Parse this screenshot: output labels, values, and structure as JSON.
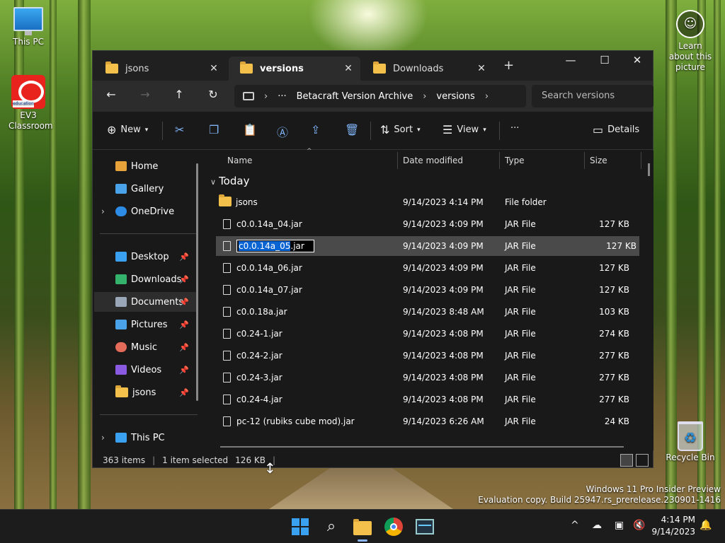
{
  "desktop": {
    "icons": [
      {
        "label": "This PC",
        "icon": "monitor-icon"
      },
      {
        "label": "EV3 Classroom",
        "icon": "ev3-app-icon"
      },
      {
        "label": "Recycle Bin",
        "icon": "recycle-bin-icon"
      },
      {
        "label": "Learn about this picture",
        "icon": "learn-picture-icon"
      }
    ],
    "watermark": {
      "line1": "Windows 11 Pro Insider Preview",
      "line2": "Evaluation copy. Build 25947.rs_prerelease.230901-1416"
    }
  },
  "window": {
    "tabs": [
      {
        "label": "jsons",
        "active": false
      },
      {
        "label": "versions",
        "active": true
      },
      {
        "label": "Downloads",
        "active": false
      }
    ],
    "new_tab": "+",
    "controls": {
      "minimize": "—",
      "maximize": "☐",
      "close": "✕"
    },
    "nav": {
      "back": "←",
      "forward": "→",
      "up": "↑",
      "refresh": "↻"
    },
    "address": {
      "ellipsis": "···",
      "crumbs": [
        "Betacraft Version Archive",
        "versions"
      ],
      "separator": "›"
    },
    "search_placeholder": "Search versions",
    "toolbar": {
      "new_label": "New",
      "sort_label": "Sort",
      "view_label": "View",
      "more_label": "···",
      "details_label": "Details"
    },
    "sidebar": {
      "items": [
        {
          "label": "Home",
          "icon": "home-icon",
          "color": "#e8a23a"
        },
        {
          "label": "Gallery",
          "icon": "gallery-icon",
          "color": "#4aa3e8"
        },
        {
          "label": "OneDrive",
          "icon": "onedrive-icon",
          "color": "#2d8ce6"
        },
        {
          "label": "Desktop",
          "icon": "desktop-icon",
          "color": "#3aa0f0"
        },
        {
          "label": "Downloads",
          "icon": "download-icon",
          "color": "#33b36b"
        },
        {
          "label": "Documents",
          "icon": "documents-icon",
          "color": "#9aa7b8"
        },
        {
          "label": "Pictures",
          "icon": "pictures-icon",
          "color": "#4aa3e8"
        },
        {
          "label": "Music",
          "icon": "music-icon",
          "color": "#e46a5a"
        },
        {
          "label": "Videos",
          "icon": "videos-icon",
          "color": "#8a5ae0"
        },
        {
          "label": "jsons",
          "icon": "folder-icon",
          "color": "#f3c14b"
        },
        {
          "label": "This PC",
          "icon": "this-pc-icon",
          "color": "#3aa0f0"
        }
      ]
    },
    "columns": {
      "name": "Name",
      "date": "Date modified",
      "type": "Type",
      "size": "Size"
    },
    "group_label": "Today",
    "files": [
      {
        "name": "jsons",
        "date": "9/14/2023 4:14 PM",
        "type": "File folder",
        "size": "",
        "folder": true
      },
      {
        "name": "c0.0.14a_04.jar",
        "date": "9/14/2023 4:09 PM",
        "type": "JAR File",
        "size": "127 KB"
      },
      {
        "name_selected": "c0.0.14a_05",
        "name_rest": ".jar",
        "date": "9/14/2023 4:09 PM",
        "type": "JAR File",
        "size": "127 KB",
        "renaming": true
      },
      {
        "name": "c0.0.14a_06.jar",
        "date": "9/14/2023 4:09 PM",
        "type": "JAR File",
        "size": "127 KB"
      },
      {
        "name": "c0.0.14a_07.jar",
        "date": "9/14/2023 4:09 PM",
        "type": "JAR File",
        "size": "127 KB"
      },
      {
        "name": "c0.0.18a.jar",
        "date": "9/14/2023 8:48 AM",
        "type": "JAR File",
        "size": "103 KB"
      },
      {
        "name": "c0.24-1.jar",
        "date": "9/14/2023 4:08 PM",
        "type": "JAR File",
        "size": "274 KB"
      },
      {
        "name": "c0.24-2.jar",
        "date": "9/14/2023 4:08 PM",
        "type": "JAR File",
        "size": "277 KB"
      },
      {
        "name": "c0.24-3.jar",
        "date": "9/14/2023 4:08 PM",
        "type": "JAR File",
        "size": "277 KB"
      },
      {
        "name": "c0.24-4.jar",
        "date": "9/14/2023 4:08 PM",
        "type": "JAR File",
        "size": "277 KB"
      },
      {
        "name": "pc-12 (rubiks cube mod).jar",
        "date": "9/14/2023 6:26 AM",
        "type": "JAR File",
        "size": "24 KB"
      }
    ],
    "status": {
      "count": "363 items",
      "selected": "1 item selected",
      "size": "126 KB",
      "sep": "|"
    }
  },
  "taskbar": {
    "apps": [
      "start-icon",
      "search-icon",
      "file-explorer-icon",
      "chrome-icon",
      "task-manager-icon"
    ],
    "tray": {
      "chevron": "^"
    },
    "time": "4:14 PM",
    "date": "9/14/2023"
  }
}
